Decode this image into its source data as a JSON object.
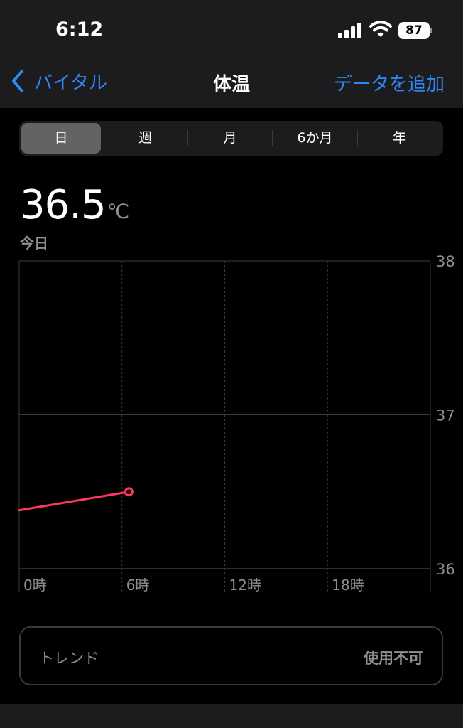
{
  "status_bar": {
    "time": "6:12",
    "battery": "87"
  },
  "nav": {
    "back_label": "バイタル",
    "title": "体温",
    "add_label": "データを追加"
  },
  "segments": [
    {
      "label": "日",
      "active": true
    },
    {
      "label": "週",
      "active": false
    },
    {
      "label": "月",
      "active": false
    },
    {
      "label": "6か月",
      "active": false
    },
    {
      "label": "年",
      "active": false
    }
  ],
  "summary": {
    "value": "36.5",
    "unit": "℃",
    "date_label": "今日"
  },
  "chart_data": {
    "type": "line",
    "x_ticks": [
      "0時",
      "6時",
      "12時",
      "18時"
    ],
    "y_ticks": [
      "36",
      "37",
      "38"
    ],
    "ylim": [
      36,
      38
    ],
    "xlim": [
      0,
      24
    ],
    "series": [
      {
        "points": [
          {
            "x": 0,
            "y": 36.38
          },
          {
            "x": 6.4,
            "y": 36.5
          }
        ]
      }
    ],
    "grid": true,
    "line_color": "#ff375f"
  },
  "trend": {
    "label": "トレンド",
    "value": "使用不可"
  },
  "colors": {
    "accent": "#2f86f5",
    "background": "#000000",
    "surface": "#1c1c1e"
  }
}
